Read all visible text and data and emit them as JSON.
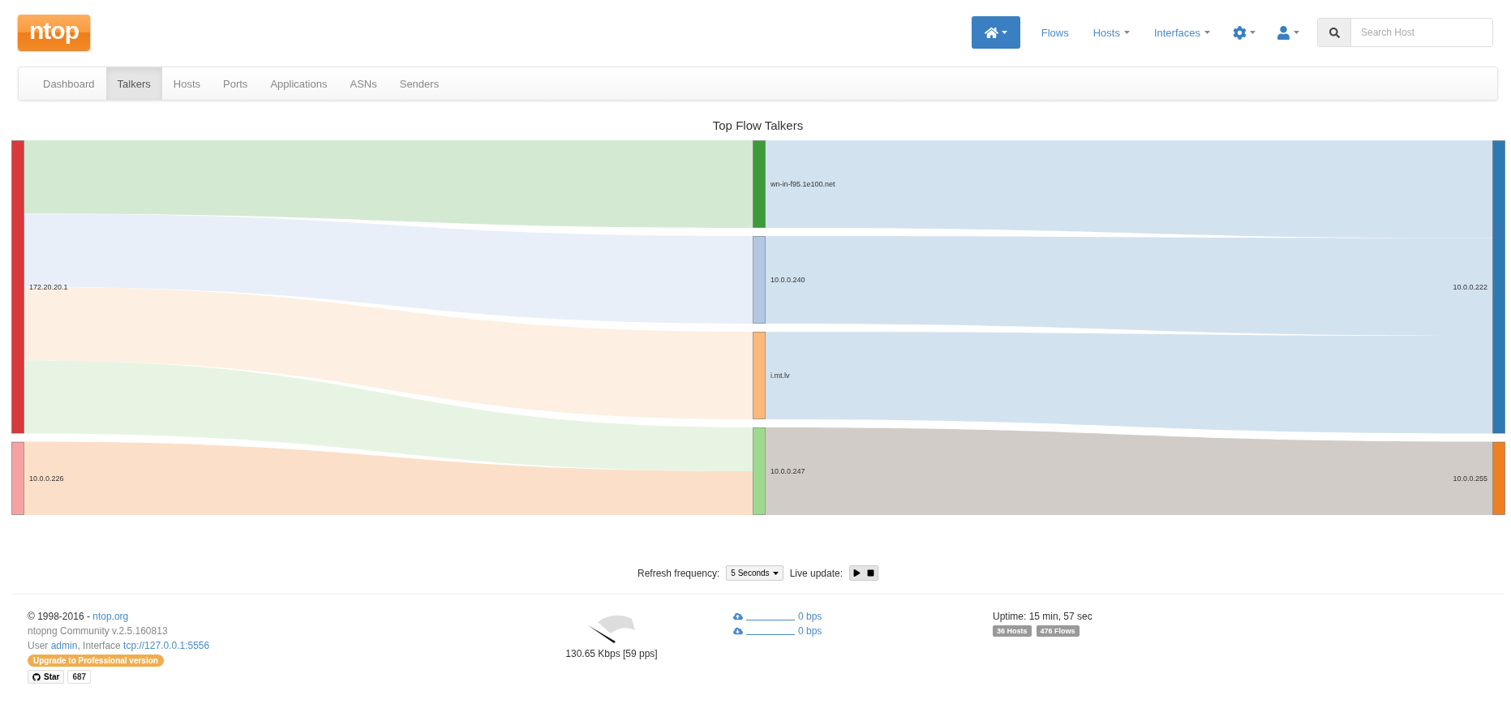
{
  "header": {
    "logo": "ntop",
    "nav": [
      {
        "kind": "home",
        "selected": true
      },
      {
        "kind": "link",
        "label": "Flows",
        "dropdown": false
      },
      {
        "kind": "link",
        "label": "Hosts",
        "dropdown": true
      },
      {
        "kind": "link",
        "label": "Interfaces",
        "dropdown": true
      },
      {
        "kind": "settings"
      },
      {
        "kind": "user"
      }
    ],
    "search": {
      "placeholder": "Search Host"
    }
  },
  "tabs": [
    {
      "label": "Dashboard",
      "selected": false
    },
    {
      "label": "Talkers",
      "selected": true
    },
    {
      "label": "Hosts",
      "selected": false
    },
    {
      "label": "Ports",
      "selected": false
    },
    {
      "label": "Applications",
      "selected": false
    },
    {
      "label": "ASNs",
      "selected": false
    },
    {
      "label": "Senders",
      "selected": false
    }
  ],
  "sankey": {
    "title": "Top Flow Talkers",
    "columns": [
      {
        "nodes": [
          {
            "label": "172.20.20.1",
            "color": "#d9393b"
          },
          {
            "label": "10.0.0.226",
            "color": "#f4a3a3"
          }
        ]
      },
      {
        "nodes": [
          {
            "label": "wn-in-f95.1e100.net",
            "color": "#3e9b3a"
          },
          {
            "label": "10.0.0.240",
            "color": "#b1c7e4"
          },
          {
            "label": "i.mt.lv",
            "color": "#fbb87a"
          },
          {
            "label": "10.0.0.247",
            "color": "#9fd98f"
          }
        ]
      },
      {
        "nodes": [
          {
            "label": "10.0.0.222",
            "color": "#2f79b3"
          },
          {
            "label": "10.0.0.255",
            "color": "#ee7f22"
          }
        ]
      }
    ]
  },
  "refresh": {
    "label": "Refresh frequency:",
    "value": "5 Seconds",
    "live_label": "Live update:"
  },
  "footer": {
    "copyright": "© 1998-2016 -",
    "site_link": "ntop.org",
    "version": "ntopng Community v.2.5.160813",
    "user_prefix": "User",
    "user": "admin",
    "interface_prefix": ", Interface",
    "interface": "tcp://127.0.0.1:5556",
    "upgrade": "Upgrade to Professional version",
    "star": "Star",
    "star_count": "687",
    "throughput": "130.65 Kbps [59 pps]",
    "rates": [
      {
        "kind": "upload",
        "value": "0 bps"
      },
      {
        "kind": "download",
        "value": "0 bps"
      }
    ],
    "uptime": "Uptime: 15 min, 57 sec",
    "badges": [
      "36 Hosts",
      "476 Flows"
    ]
  }
}
